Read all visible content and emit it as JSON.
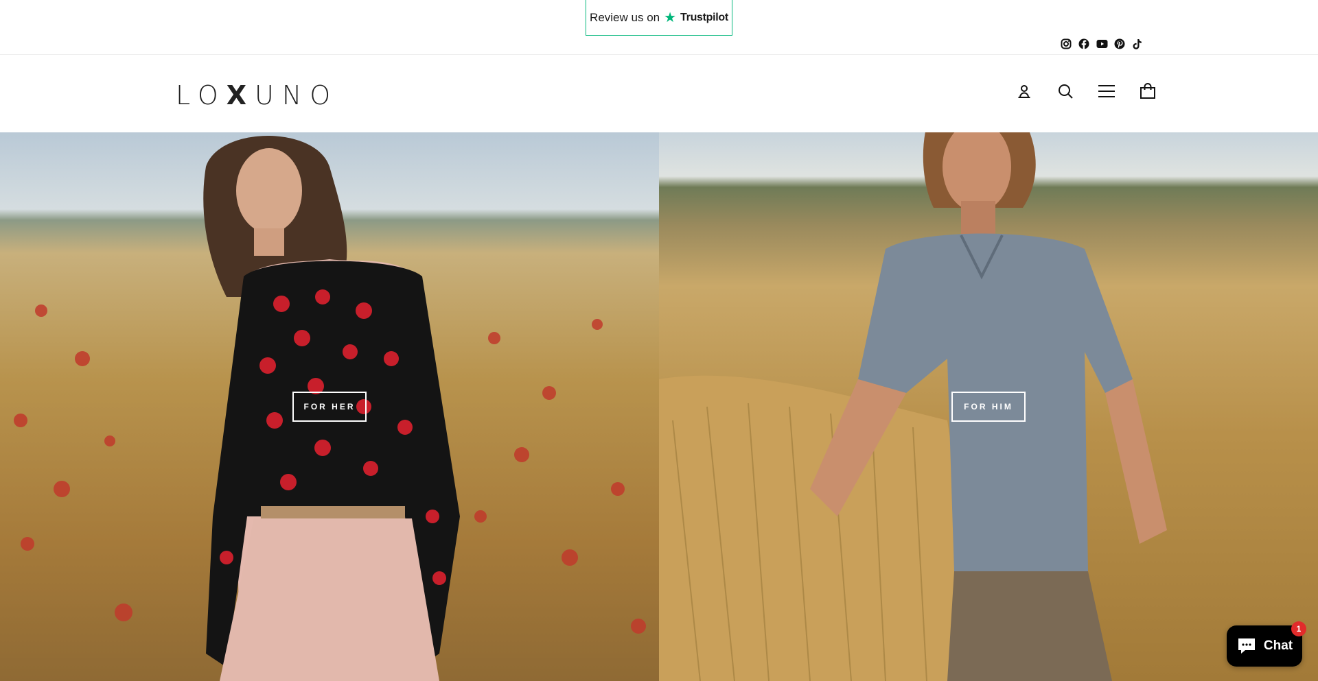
{
  "trustpilot": {
    "prefix": "Review us on",
    "brand": "Trustpilot"
  },
  "socials": [
    {
      "name": "instagram-icon"
    },
    {
      "name": "facebook-icon"
    },
    {
      "name": "youtube-icon"
    },
    {
      "name": "pinterest-icon"
    },
    {
      "name": "tiktok-icon"
    }
  ],
  "brand": {
    "logo_left": "LO",
    "logo_x": "X",
    "logo_right": "UNO"
  },
  "header_icons": [
    "account-icon",
    "search-icon",
    "menu-icon",
    "cart-icon"
  ],
  "hero": {
    "her_label": "FOR HER",
    "him_label": "FOR HIM"
  },
  "chat": {
    "label": "Chat",
    "badge": "1"
  },
  "colors": {
    "accent_trustpilot": "#00b67a",
    "chat_bg": "#000000",
    "badge": "#e22b2b"
  }
}
